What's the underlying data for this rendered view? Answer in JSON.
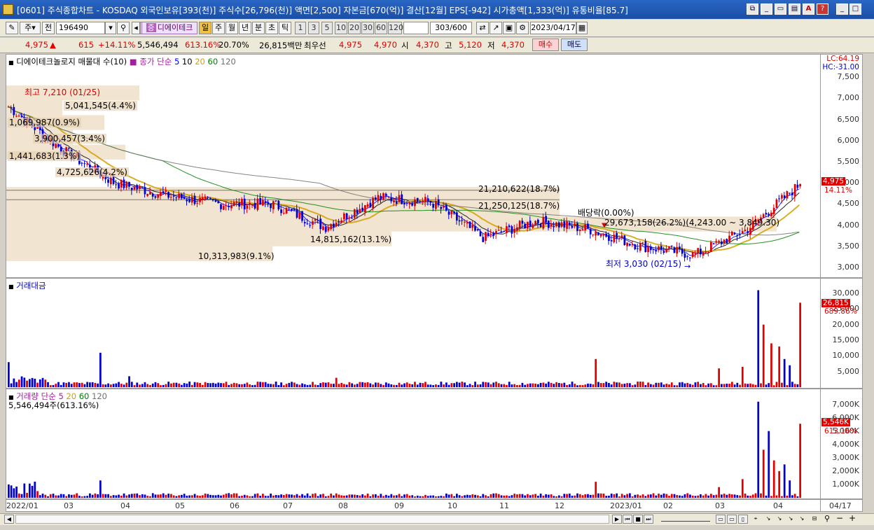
{
  "window": {
    "title": "[0601] 주식종합차트 - KOSDAQ 외국인보유[393(천)] 주식수[26,796(천)] 액면[2,500] 자본금[670(억)] 결산[12월] EPS[-942] 시가총액[1,333(억)] 유통비율[85.7]"
  },
  "toolbar": {
    "market_select": "주",
    "market_btn": "전",
    "code": "196490",
    "stock_name": "디에이테크",
    "periods": [
      "일",
      "주",
      "월",
      "년",
      "분",
      "초",
      "틱"
    ],
    "intervals": [
      "1",
      "3",
      "5",
      "10",
      "20",
      "30",
      "60",
      "120"
    ],
    "count": "303",
    "count_total": "/600",
    "date": "2023/04/17"
  },
  "quote": {
    "price": "4,975",
    "change": "615",
    "change_pct": "+14.11%",
    "volume": "5,546,494",
    "volume_ratio": "613.16%",
    "turnover": "20.70%",
    "amount": "26,815백만",
    "best_label": "최우선",
    "ask": "4,975",
    "bid": "4,970",
    "open_label": "시",
    "open": "4,370",
    "high_label": "고",
    "high": "5,120",
    "low_label": "저",
    "low": "4,370",
    "buy_label": "매수",
    "sell_label": "매도"
  },
  "price_panel": {
    "legend_title": "디에이테크놀로지 매물대 수(10)",
    "legend_ma_label": "종가 단순",
    "ma_periods": [
      "5",
      "10",
      "20",
      "60",
      "120"
    ],
    "ma_colors": [
      "#0000ff",
      "#000000",
      "#d4a000",
      "#008000",
      "#707070"
    ],
    "lc": "LC:64.19",
    "hc": "HC:-31.00",
    "current_tag": "4,975",
    "current_pct": "14.11%",
    "high_note": "최고 7,210 (01/25)",
    "low_note": "최저 3,030 (02/15)",
    "dividend_note": "배당락(0.00%)",
    "volume_profile": [
      "5,041,545(4.4%)",
      "1,069,987(0.9%)",
      "3,900,457(3.4%)",
      "1,441,683(1.3%)",
      "4,725,626(4.2%)",
      "21,210,622(18.7%)",
      "21,250,125(18.7%)",
      "29,673,158(26.2%)(4,243.00 ~ 3,849.30)",
      "14,815,162(13.1%)",
      "10,313,983(9.1%)"
    ]
  },
  "amount_panel": {
    "legend": "거래대금",
    "current_tag": "26,815",
    "current_pct": "689.86%"
  },
  "volume_panel": {
    "legend_title": "거래량 단순",
    "ma_periods": [
      "5",
      "20",
      "60",
      "120"
    ],
    "value_text": "5,546,494주(613.16%)",
    "current_tag": "5,546K",
    "current_pct": "613.16%"
  },
  "x_axis": {
    "labels": [
      "2022/01",
      "03",
      "04",
      "05",
      "06",
      "07",
      "08",
      "09",
      "10",
      "11",
      "12",
      "2023/01",
      "02",
      "03",
      "04"
    ],
    "end_label": "04/17"
  },
  "chart_data": [
    {
      "type": "candlestick",
      "title": "디에이테크놀로지 매물대 수(10)",
      "y_ticks": [
        "7,500",
        "7,000",
        "6,500",
        "6,000",
        "5,500",
        "5,000",
        "4,500",
        "4,000",
        "3,500",
        "3,000"
      ],
      "ylim": [
        2900,
        7700
      ],
      "monthly_close": [
        {
          "x": "2022/01",
          "close": 6800
        },
        {
          "x": "2022/02",
          "close": 5800
        },
        {
          "x": "2022/03",
          "close": 5000
        },
        {
          "x": "2022/04",
          "close": 4700
        },
        {
          "x": "2022/05",
          "close": 4500
        },
        {
          "x": "2022/06",
          "close": 4500
        },
        {
          "x": "2022/07",
          "close": 3950
        },
        {
          "x": "2022/08",
          "close": 4650
        },
        {
          "x": "2022/09",
          "close": 4550
        },
        {
          "x": "2022/10",
          "close": 3700
        },
        {
          "x": "2022/11",
          "close": 4100
        },
        {
          "x": "2022/12",
          "close": 3900
        },
        {
          "x": "2023/01",
          "close": 3500
        },
        {
          "x": "2023/02",
          "close": 3300
        },
        {
          "x": "2023/03",
          "close": 3900
        },
        {
          "x": "2023/04",
          "close": 4975
        }
      ]
    },
    {
      "type": "bar",
      "title": "거래대금",
      "y_ticks": [
        "30,000",
        "25,000",
        "20,000",
        "15,000",
        "10,000",
        "5,000"
      ],
      "ylim": [
        0,
        32000
      ]
    },
    {
      "type": "bar",
      "title": "거래량",
      "y_ticks": [
        "7,000K",
        "6,000K",
        "5,000K",
        "4,000K",
        "3,000K",
        "2,000K",
        "1,000K"
      ],
      "ylim": [
        0,
        7500
      ]
    }
  ]
}
